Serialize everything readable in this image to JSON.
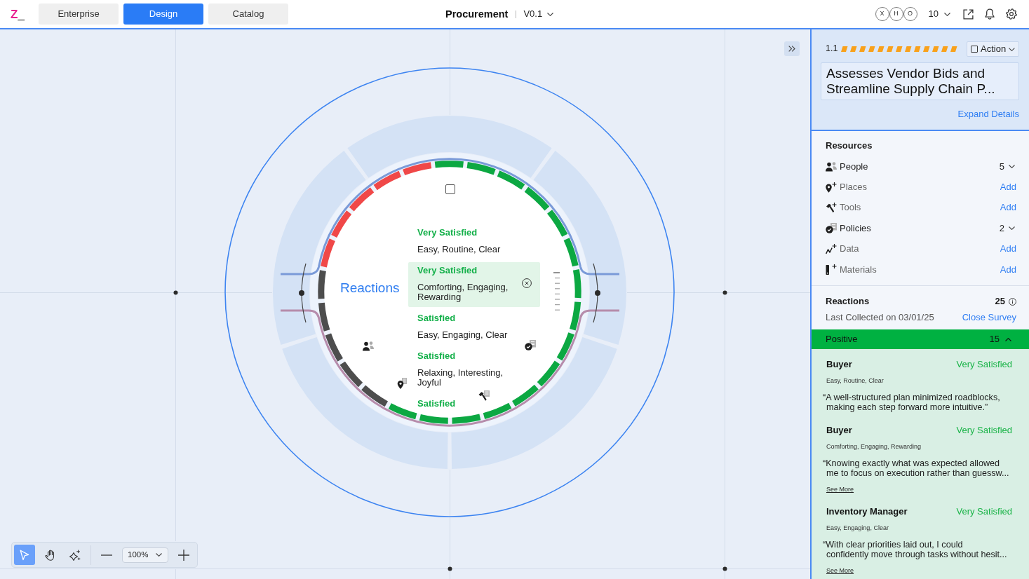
{
  "header": {
    "logo": {
      "letter": "Z",
      "cursor": "_"
    },
    "tabs": [
      {
        "label": "Enterprise",
        "selected": false
      },
      {
        "label": "Design",
        "selected": true
      },
      {
        "label": "Catalog",
        "selected": false
      }
    ],
    "project": "Procurement",
    "version": "V0.1",
    "avatars": [
      "X",
      "H",
      "O"
    ],
    "count": "10"
  },
  "canvas": {
    "dial": {
      "title": "Reactions",
      "checked": false,
      "items": [
        {
          "rating": "Very Satisfied",
          "feelings": "Easy, Routine, Clear",
          "selected": false
        },
        {
          "rating": "Very Satisfied",
          "feelings": "Comforting, Engaging, Rewarding",
          "selected": true
        },
        {
          "rating": "Satisfied",
          "feelings": "Easy, Engaging, Clear",
          "selected": false
        },
        {
          "rating": "Satisfied",
          "feelings": "Relaxing, Interesting, Joyful",
          "selected": false
        },
        {
          "rating": "Satisfied",
          "selected": false
        }
      ],
      "ring": [
        {
          "color": "#f04848"
        },
        {
          "color": "#f04848"
        },
        {
          "color": "#f04848"
        },
        {
          "color": "#f04848"
        },
        {
          "color": "#f04848"
        },
        {
          "color": "#0ca842"
        },
        {
          "color": "#0ca842"
        },
        {
          "color": "#0ca842"
        },
        {
          "color": "#0ca842"
        },
        {
          "color": "#0ca842"
        },
        {
          "color": "#0ca842"
        },
        {
          "color": "#0ca842"
        },
        {
          "color": "#0ca842"
        },
        {
          "color": "#0ca842"
        },
        {
          "color": "#0ca842"
        },
        {
          "color": "#0ca842"
        },
        {
          "color": "#0ca842"
        },
        {
          "color": "#0ca842"
        },
        {
          "color": "#0ca842"
        },
        {
          "color": "#0ca842"
        },
        {
          "color": "#4d4d4d"
        },
        {
          "color": "#4d4d4d"
        },
        {
          "color": "#4d4d4d"
        },
        {
          "color": "#4d4d4d"
        },
        {
          "color": "#4d4d4d"
        }
      ]
    },
    "toolbar": {
      "tools": [
        {
          "kind": "select",
          "selected": true
        },
        {
          "kind": "hand",
          "selected": false
        },
        {
          "kind": "ai",
          "selected": false
        }
      ],
      "zoom": "100%"
    }
  },
  "panel": {
    "step": {
      "number": "1.1",
      "action": "Action",
      "checked": false,
      "title": "Assesses Vendor Bids and Streamline Supply Chain P...",
      "expand": "Expand Details"
    },
    "resources": {
      "heading": "Resources",
      "items": [
        {
          "kind": "people",
          "label": "People",
          "count": "5",
          "expanded": false
        },
        {
          "kind": "places",
          "label": "Places",
          "action": "Add"
        },
        {
          "kind": "tools",
          "label": "Tools",
          "action": "Add"
        },
        {
          "kind": "policies",
          "label": "Policies",
          "count": "2",
          "expanded": false
        },
        {
          "kind": "data",
          "label": "Data",
          "action": "Add"
        },
        {
          "kind": "materials",
          "label": "Materials",
          "action": "Add"
        }
      ]
    },
    "reactions": {
      "heading": "Reactions",
      "total": "25",
      "collected": "Last Collected on 03/01/25",
      "close": "Close Survey",
      "group": {
        "label": "Positive",
        "count": "15",
        "expanded": true
      },
      "responses": [
        {
          "role": "Buyer",
          "rating": "Very Satisfied",
          "feelings": "Easy, Routine, Clear",
          "quote": "“A well-structured plan minimized roadblocks,\nmaking each step forward more intuitive.”"
        },
        {
          "role": "Buyer",
          "rating": "Very Satisfied",
          "feelings": "Comforting, Engaging, Rewarding",
          "quote": "“Knowing exactly what was expected allowed\nme to focus on execution rather than guessw...",
          "more": "See More"
        },
        {
          "role": "Inventory Manager",
          "rating": "Very Satisfied",
          "feelings": "Easy, Engaging, Clear",
          "quote": "“With clear priorities laid out, I could\nconfidently move through tasks without hesit...",
          "more": "See More"
        }
      ]
    }
  }
}
